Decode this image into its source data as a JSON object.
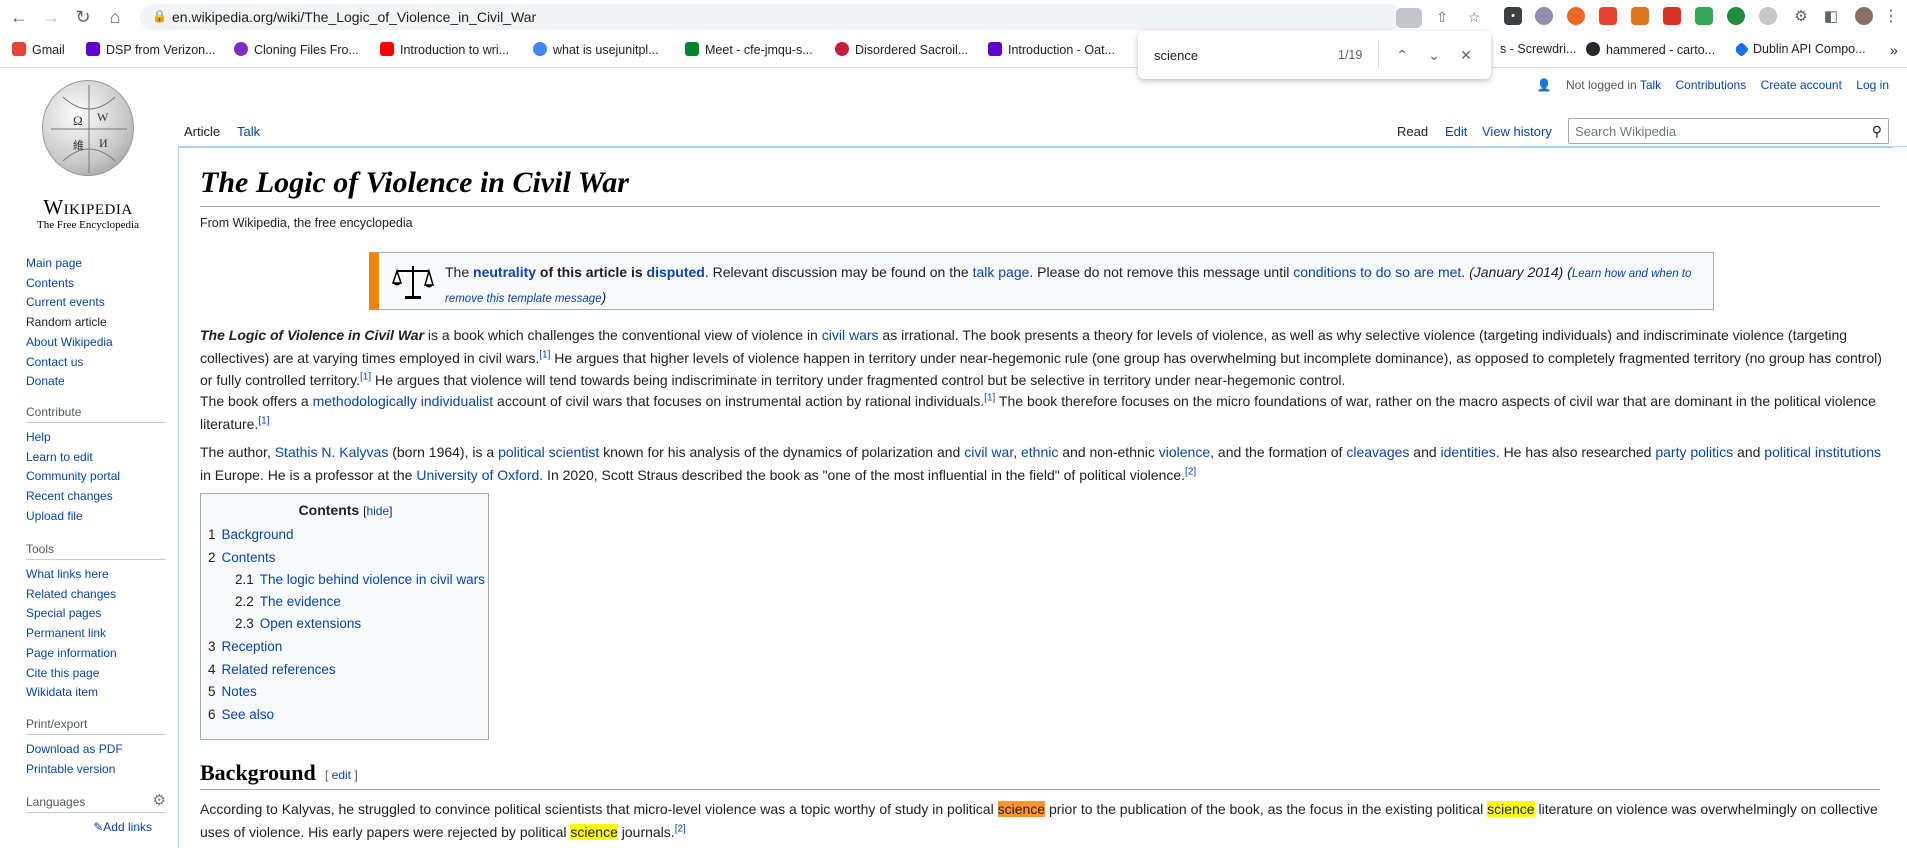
{
  "browser": {
    "url": "en.wikipedia.org/wiki/The_Logic_of_Violence_in_Civil_War",
    "bookmarks": [
      "Gmail",
      "DSP from Verizon...",
      "Cloning Files Fro...",
      "Introduction to wri...",
      "what is usejunitpl...",
      "Meet - cfe-jmqu-s...",
      "Disordered Sacroil...",
      "Introduction - Oat...",
      "s - Screwdri...",
      "hammered - carto...",
      "Dublin API Compo..."
    ],
    "find": {
      "query": "science",
      "count": "1/19"
    }
  },
  "wiki": {
    "wordmark": "Wikipedia",
    "tagline": "The Free Encyclopedia",
    "nav": [
      "Main page",
      "Contents",
      "Current events",
      "Random article",
      "About Wikipedia",
      "Contact us",
      "Donate"
    ],
    "contribute_heading": "Contribute",
    "contribute": [
      "Help",
      "Learn to edit",
      "Community portal",
      "Recent changes",
      "Upload file"
    ],
    "tools_heading": "Tools",
    "tools": [
      "What links here",
      "Related changes",
      "Special pages",
      "Permanent link",
      "Page information",
      "Cite this page",
      "Wikidata item"
    ],
    "print_heading": "Print/export",
    "print": [
      "Download as PDF",
      "Printable version"
    ],
    "languages_heading": "Languages",
    "add_links": "Add links",
    "user": {
      "not_logged": "Not logged in",
      "talk": "Talk",
      "contributions": "Contributions",
      "create": "Create account",
      "login": "Log in"
    },
    "tabs": {
      "article": "Article",
      "talk": "Talk",
      "read": "Read",
      "edit": "Edit",
      "history": "View history"
    },
    "search_placeholder": "Search Wikipedia"
  },
  "article": {
    "title": "The Logic of Violence in Civil War",
    "subtitle": "From Wikipedia, the free encyclopedia",
    "notice": {
      "p1": "The ",
      "neutrality": "neutrality",
      "p2": " of this article is ",
      "disputed": "disputed",
      "p3": ". Relevant discussion may be found on the ",
      "talk_page": "talk page",
      "p4": ". Please do not remove this message until ",
      "conditions": "conditions to do so are met",
      "p5": ". ",
      "date": "(January 2014)",
      "p6": " (",
      "learn": "Learn how and when to remove this template message",
      "p7": ")"
    },
    "toc": {
      "title": "Contents",
      "hide": "hide",
      "items": [
        {
          "num": "1",
          "label": "Background"
        },
        {
          "num": "2",
          "label": "Contents"
        },
        {
          "num": "2.1",
          "label": "The logic behind violence in civil wars"
        },
        {
          "num": "2.2",
          "label": "The evidence"
        },
        {
          "num": "2.3",
          "label": "Open extensions"
        },
        {
          "num": "3",
          "label": "Reception"
        },
        {
          "num": "4",
          "label": "Related references"
        },
        {
          "num": "5",
          "label": "Notes"
        },
        {
          "num": "6",
          "label": "See also"
        }
      ]
    },
    "background_heading": "Background",
    "edit_label": "edit"
  }
}
